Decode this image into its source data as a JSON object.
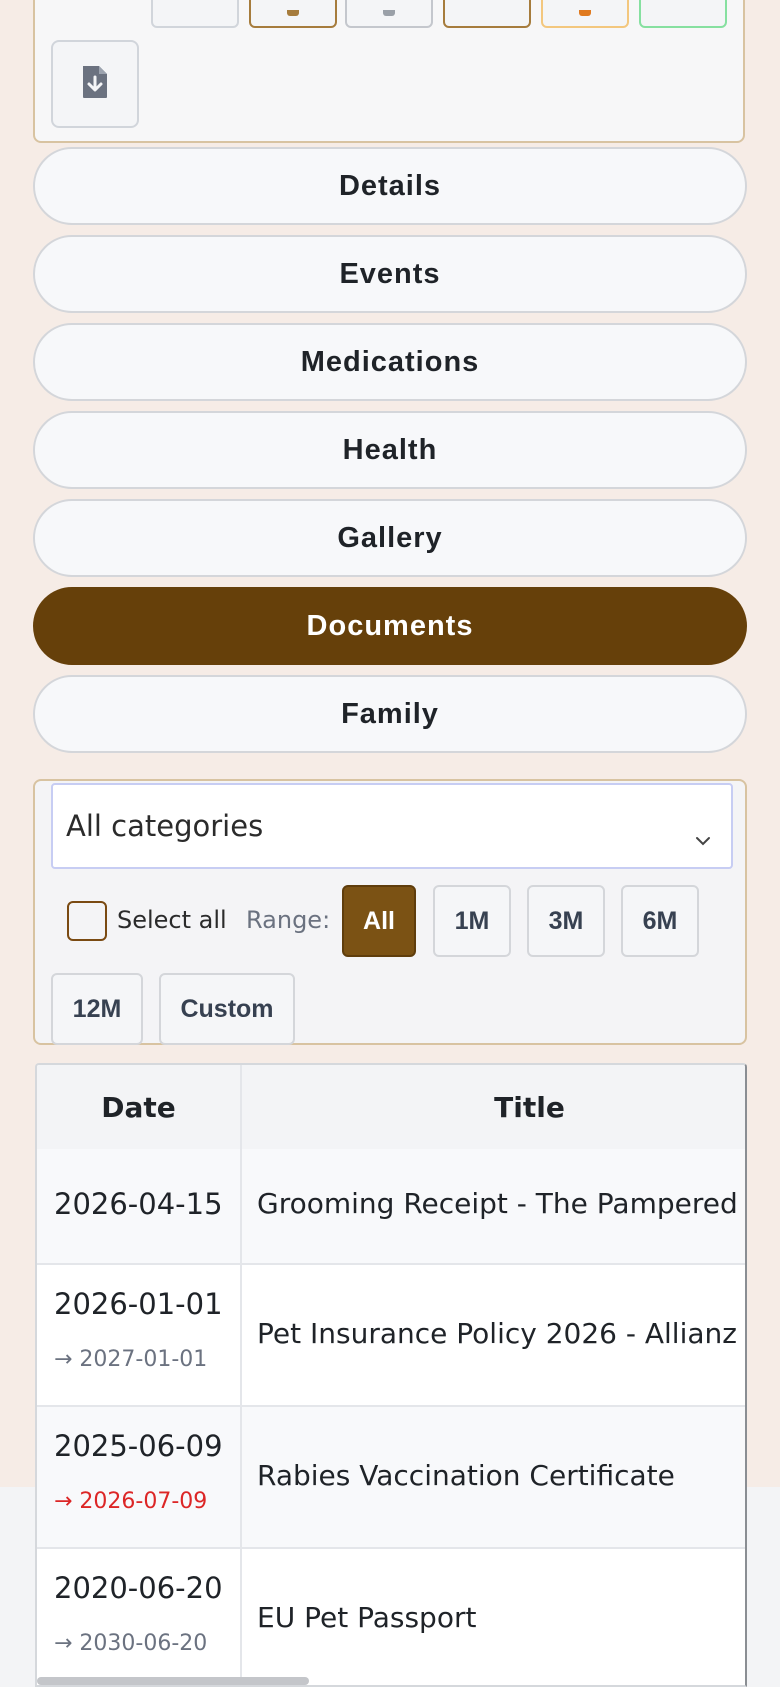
{
  "toolbar": {
    "buttons": [
      {
        "name": "toolbar-button-1",
        "accent": "#d1d5db"
      },
      {
        "name": "toolbar-button-2",
        "accent": "#a67c3d"
      },
      {
        "name": "toolbar-button-3",
        "accent": "#c4c7cd"
      },
      {
        "name": "toolbar-button-4",
        "accent": "#a67c3d"
      },
      {
        "name": "toolbar-button-5",
        "accent": "#f3c77e"
      },
      {
        "name": "toolbar-button-6",
        "accent": "#86e0a0"
      }
    ],
    "export_icon": "file-download-icon"
  },
  "tabs": [
    {
      "label": "Details",
      "active": false
    },
    {
      "label": "Events",
      "active": false
    },
    {
      "label": "Medications",
      "active": false
    },
    {
      "label": "Health",
      "active": false
    },
    {
      "label": "Gallery",
      "active": false
    },
    {
      "label": "Documents",
      "active": true
    },
    {
      "label": "Family",
      "active": false
    }
  ],
  "filters": {
    "category_select": "All categories",
    "select_all_label": "Select all",
    "range_label": "Range:",
    "ranges": [
      {
        "label": "All",
        "active": true
      },
      {
        "label": "1M",
        "active": false
      },
      {
        "label": "3M",
        "active": false
      },
      {
        "label": "6M",
        "active": false
      },
      {
        "label": "12M",
        "active": false
      },
      {
        "label": "Custom",
        "active": false
      }
    ]
  },
  "table": {
    "headers": {
      "date": "Date",
      "title": "Title"
    },
    "rows": [
      {
        "date": "2026-04-15",
        "expiry": "",
        "expired": false,
        "title": "Grooming Receipt - The Pampered Paw"
      },
      {
        "date": "2026-01-01",
        "expiry": "→ 2027-01-01",
        "expired": false,
        "title": "Pet Insurance Policy 2026 - Allianz"
      },
      {
        "date": "2025-06-09",
        "expiry": "→ 2026-07-09",
        "expired": true,
        "title": "Rabies Vaccination Certificate"
      },
      {
        "date": "2020-06-20",
        "expiry": "→ 2030-06-20",
        "expired": false,
        "title": "EU Pet Passport"
      }
    ]
  },
  "colors": {
    "accent": "#66400a",
    "range_active": "#7b5214",
    "expired": "#dc2626",
    "muted": "#6b7280"
  }
}
